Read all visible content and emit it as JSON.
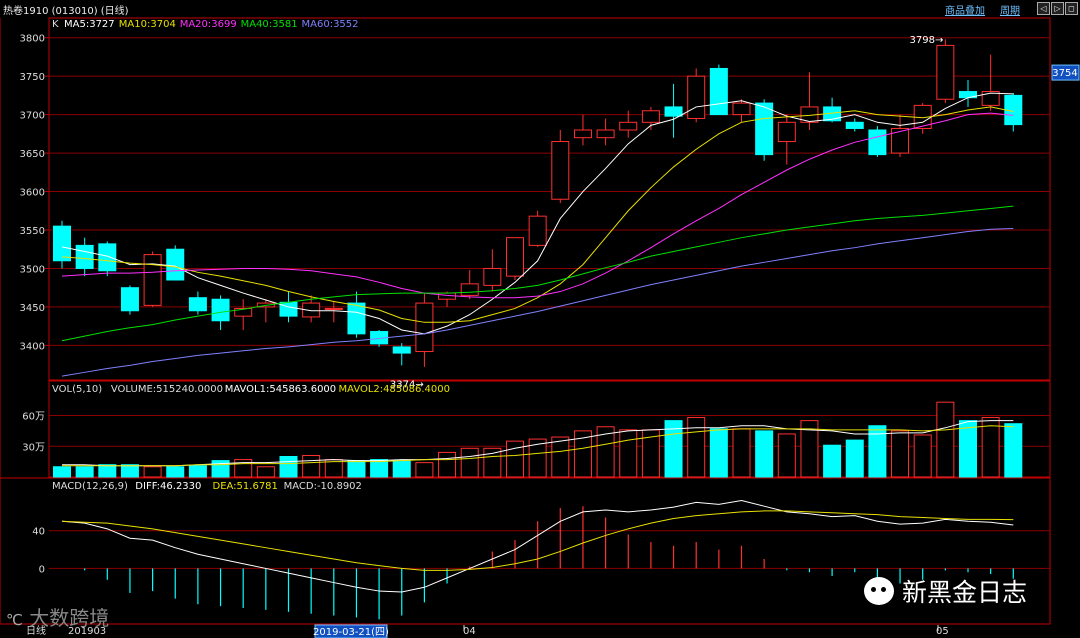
{
  "header": {
    "title": "热卷1910 (013010) (日线)",
    "links": [
      "商品叠加",
      "周期"
    ],
    "window_buttons": [
      "◁",
      "▷",
      "◻"
    ]
  },
  "main_panel": {
    "legend_prefix": "K",
    "ma_legend": [
      {
        "label": "MA5:3727",
        "color": "#ffffff"
      },
      {
        "label": "MA10:3704",
        "color": "#e8e000"
      },
      {
        "label": "MA20:3699",
        "color": "#ff30ff"
      },
      {
        "label": "MA40:3581",
        "color": "#00e000"
      },
      {
        "label": "MA60:3552",
        "color": "#8080ff"
      }
    ],
    "price_ticks": [
      "3800",
      "3750",
      "3700",
      "3650",
      "3600",
      "3550",
      "3500",
      "3450",
      "3400"
    ],
    "price_badge": "3754",
    "high_label": "3798→",
    "low_label": "3374→"
  },
  "volume_panel": {
    "legend": [
      {
        "label": "VOL(5,10)",
        "color": "#dddddd"
      },
      {
        "label": "VOLUME:515240.0000",
        "color": "#dddddd"
      },
      {
        "label": "MAVOL1:545863.6000",
        "color": "#ffffff"
      },
      {
        "label": "MAVOL2:485086.4000",
        "color": "#e8e000"
      }
    ],
    "ticks": [
      "60万",
      "30万"
    ]
  },
  "macd_panel": {
    "legend": [
      {
        "label": "MACD(12,26,9)",
        "color": "#dddddd"
      },
      {
        "label": "DIFF:46.2330",
        "color": "#ffffff"
      },
      {
        "label": "DEA:51.6781",
        "color": "#e8e000"
      },
      {
        "label": "MACD:-10.8902",
        "color": "#dddddd"
      }
    ],
    "ticks": [
      "40",
      "0"
    ]
  },
  "x_axis": {
    "period_label": "日线",
    "labels": [
      "201903",
      "04",
      "05"
    ],
    "cursor_date": "2019-03-21(四)"
  },
  "watermark_left": "大数跨境",
  "watermark_right": "新黑金日志",
  "colors": {
    "up": "#ff3030",
    "down": "#00ffff",
    "grid": "#8b0000",
    "axis": "#c00000"
  },
  "chart_data": {
    "type": "candlestick",
    "ohlc": [
      [
        3555,
        3562,
        3500,
        3510
      ],
      [
        3530,
        3540,
        3490,
        3500
      ],
      [
        3532,
        3535,
        3490,
        3497
      ],
      [
        3475,
        3478,
        3440,
        3445
      ],
      [
        3452,
        3522,
        3450,
        3518
      ],
      [
        3525,
        3530,
        3488,
        3485
      ],
      [
        3462,
        3470,
        3440,
        3445
      ],
      [
        3460,
        3465,
        3420,
        3432
      ],
      [
        3438,
        3460,
        3420,
        3448
      ],
      [
        3450,
        3460,
        3430,
        3455
      ],
      [
        3456,
        3470,
        3430,
        3438
      ],
      [
        3437,
        3465,
        3430,
        3455
      ],
      [
        3447,
        3458,
        3430,
        3448
      ],
      [
        3455,
        3470,
        3410,
        3415
      ],
      [
        3418,
        3420,
        3398,
        3402
      ],
      [
        3398,
        3403,
        3374,
        3390
      ],
      [
        3392,
        3468,
        3372,
        3455
      ],
      [
        3460,
        3470,
        3450,
        3468
      ],
      [
        3465,
        3498,
        3460,
        3480
      ],
      [
        3478,
        3525,
        3470,
        3500
      ],
      [
        3490,
        3535,
        3485,
        3540
      ],
      [
        3530,
        3575,
        3528,
        3568
      ],
      [
        3590,
        3680,
        3585,
        3665
      ],
      [
        3670,
        3700,
        3660,
        3680
      ],
      [
        3670,
        3695,
        3660,
        3680
      ],
      [
        3680,
        3705,
        3670,
        3690
      ],
      [
        3690,
        3710,
        3680,
        3705
      ],
      [
        3710,
        3740,
        3670,
        3698
      ],
      [
        3695,
        3760,
        3690,
        3750
      ],
      [
        3760,
        3765,
        3700,
        3700
      ],
      [
        3700,
        3720,
        3690,
        3715
      ],
      [
        3715,
        3720,
        3640,
        3648
      ],
      [
        3665,
        3700,
        3635,
        3690
      ],
      [
        3690,
        3755,
        3680,
        3710
      ],
      [
        3710,
        3722,
        3690,
        3692
      ],
      [
        3690,
        3695,
        3678,
        3682
      ],
      [
        3680,
        3685,
        3645,
        3648
      ],
      [
        3650,
        3700,
        3645,
        3682
      ],
      [
        3682,
        3715,
        3675,
        3712
      ],
      [
        3720,
        3798,
        3715,
        3790
      ],
      [
        3730,
        3745,
        3710,
        3722
      ],
      [
        3712,
        3778,
        3705,
        3730
      ],
      [
        3725,
        3728,
        3678,
        3687
      ]
    ],
    "ma5": [
      3528,
      3522,
      3516,
      3505,
      3506,
      3503,
      3488,
      3478,
      3468,
      3459,
      3450,
      3445,
      3445,
      3443,
      3435,
      3420,
      3415,
      3425,
      3440,
      3460,
      3482,
      3510,
      3565,
      3600,
      3630,
      3662,
      3686,
      3694,
      3710,
      3714,
      3718,
      3710,
      3698,
      3691,
      3694,
      3700,
      3690,
      3686,
      3690,
      3708,
      3722,
      3728,
      3727
    ],
    "ma10": [
      3515,
      3513,
      3510,
      3507,
      3505,
      3502,
      3495,
      3490,
      3484,
      3478,
      3470,
      3463,
      3457,
      3452,
      3446,
      3435,
      3430,
      3430,
      3432,
      3440,
      3448,
      3462,
      3480,
      3505,
      3540,
      3575,
      3605,
      3632,
      3655,
      3675,
      3690,
      3695,
      3697,
      3699,
      3702,
      3705,
      3700,
      3698,
      3696,
      3700,
      3706,
      3710,
      3704
    ],
    "ma20": [
      3490,
      3492,
      3494,
      3494,
      3495,
      3497,
      3498,
      3499,
      3500,
      3500,
      3499,
      3497,
      3493,
      3489,
      3482,
      3474,
      3468,
      3465,
      3463,
      3462,
      3462,
      3464,
      3470,
      3480,
      3494,
      3510,
      3527,
      3545,
      3562,
      3578,
      3596,
      3612,
      3628,
      3642,
      3654,
      3664,
      3671,
      3678,
      3685,
      3692,
      3700,
      3702,
      3699
    ],
    "ma40": [
      3406,
      3412,
      3418,
      3423,
      3427,
      3433,
      3438,
      3443,
      3447,
      3452,
      3456,
      3460,
      3463,
      3466,
      3467,
      3468,
      3468,
      3468,
      3469,
      3471,
      3474,
      3478,
      3485,
      3493,
      3501,
      3508,
      3516,
      3522,
      3528,
      3534,
      3540,
      3545,
      3550,
      3554,
      3558,
      3562,
      3565,
      3567,
      3569,
      3572,
      3575,
      3578,
      3581
    ],
    "ma60": [
      3360,
      3365,
      3370,
      3374,
      3379,
      3383,
      3387,
      3390,
      3393,
      3396,
      3398,
      3401,
      3404,
      3406,
      3409,
      3412,
      3415,
      3420,
      3426,
      3432,
      3438,
      3444,
      3451,
      3458,
      3465,
      3472,
      3479,
      3485,
      3491,
      3497,
      3503,
      3508,
      3513,
      3518,
      3523,
      3527,
      3532,
      3536,
      3540,
      3544,
      3548,
      3551,
      3552
    ],
    "volume": [
      10,
      10,
      12,
      12,
      10,
      10,
      11,
      16,
      17,
      10,
      20,
      21,
      17,
      16,
      17,
      16,
      14,
      24,
      28,
      28,
      35,
      37,
      39,
      45,
      49,
      46,
      46,
      55,
      58,
      47,
      47,
      45,
      42,
      55,
      31,
      36,
      50,
      45,
      41,
      73,
      55,
      58,
      52
    ],
    "mavol1": [
      12,
      12,
      11,
      11,
      11,
      11,
      12,
      13,
      14,
      14,
      15,
      16,
      17,
      16,
      16,
      17,
      17,
      18,
      20,
      23,
      28,
      32,
      35,
      38,
      42,
      45,
      46,
      47,
      48,
      48,
      50,
      50,
      47,
      46,
      45,
      42,
      42,
      43,
      43,
      48,
      54,
      55,
      55
    ],
    "mavol2": [
      11,
      11,
      11,
      11,
      11,
      11,
      12,
      12,
      13,
      13,
      13,
      14,
      15,
      15,
      15,
      16,
      17,
      17,
      18,
      20,
      21,
      23,
      25,
      28,
      32,
      36,
      39,
      42,
      44,
      46,
      47,
      47,
      47,
      47,
      46,
      46,
      46,
      46,
      45,
      46,
      48,
      50,
      49
    ],
    "diff": [
      50,
      48,
      42,
      32,
      30,
      22,
      15,
      10,
      5,
      0,
      -5,
      -10,
      -15,
      -20,
      -24,
      -25,
      -20,
      -10,
      0,
      10,
      20,
      35,
      50,
      60,
      62,
      60,
      62,
      65,
      70,
      68,
      72,
      66,
      60,
      58,
      55,
      56,
      50,
      47,
      48,
      52,
      50,
      49,
      46
    ],
    "dea": [
      50,
      49,
      48,
      45,
      42,
      38,
      34,
      30,
      26,
      22,
      18,
      14,
      10,
      6,
      3,
      0,
      -2,
      -2,
      -1,
      1,
      5,
      10,
      18,
      27,
      35,
      42,
      48,
      53,
      56,
      58,
      60,
      61,
      61,
      60,
      59,
      58,
      57,
      55,
      54,
      53,
      52,
      52,
      51.7
    ],
    "macd": [
      0,
      -2,
      -12,
      -26,
      -24,
      -32,
      -38,
      -40,
      -42,
      -44,
      -46,
      -48,
      -50,
      -52,
      -54,
      -50,
      -36,
      -16,
      2,
      18,
      30,
      50,
      64,
      66,
      54,
      36,
      28,
      24,
      28,
      20,
      24,
      10,
      -2,
      -4,
      -8,
      -4,
      -14,
      -16,
      -12,
      -2,
      -4,
      -6,
      -10.9
    ],
    "price_range": [
      3355,
      3810
    ],
    "volume_range": [
      0,
      80
    ],
    "macd_range": [
      -60,
      80
    ],
    "xlabel": "",
    "ylabel": ""
  }
}
